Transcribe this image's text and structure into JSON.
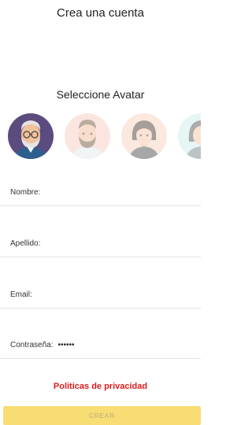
{
  "header": {
    "title": "Crea una cuenta"
  },
  "avatars": {
    "heading": "Seleccione Avatar",
    "items": [
      {
        "name": "avatar-old-man-glasses",
        "bg": "#5b4b7e",
        "selected": true
      },
      {
        "name": "avatar-bearded-man",
        "bg": "#f7c7bd",
        "selected": false
      },
      {
        "name": "avatar-woman-bob",
        "bg": "#f7cdb8",
        "selected": false
      },
      {
        "name": "avatar-woman-teal",
        "bg": "#c8ece9",
        "selected": false
      }
    ]
  },
  "form": {
    "nombre": {
      "label": "Nombre:",
      "value": ""
    },
    "apellido": {
      "label": "Apellido:",
      "value": ""
    },
    "email": {
      "label": "Email:",
      "value": ""
    },
    "password": {
      "label": "Contraseña:",
      "value": "••••••"
    }
  },
  "links": {
    "privacy": "Politicas de privacidad"
  },
  "actions": {
    "create_label": "CREAR"
  },
  "colors": {
    "accent_button": "#f8dc74",
    "privacy_link": "#e01b1b"
  }
}
